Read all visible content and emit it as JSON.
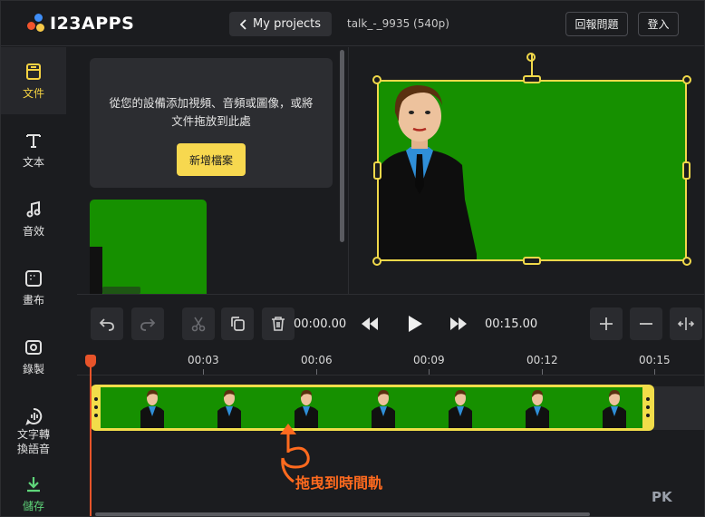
{
  "header": {
    "logo_text": "I23APPS",
    "projects_label": "My projects",
    "project_name": "talk_-_9935 (540p)",
    "report_label": "回報問題",
    "login_label": "登入"
  },
  "sidebar": {
    "items": [
      {
        "label": "文件",
        "icon": "file-icon"
      },
      {
        "label": "文本",
        "icon": "text-icon"
      },
      {
        "label": "音效",
        "icon": "music-note-icon"
      },
      {
        "label": "畫布",
        "icon": "canvas-icon"
      },
      {
        "label": "錄製",
        "icon": "record-icon"
      },
      {
        "label": "文字轉換語音",
        "label_line1": "文字轉",
        "label_line2": "換語音",
        "icon": "text-to-speech-icon"
      },
      {
        "label": "儲存",
        "icon": "download-icon"
      }
    ]
  },
  "files": {
    "drop_line1": "從您的設備添加視頻、音頻或圖像，或將",
    "drop_line2": "文件拖放到此處",
    "add_button": "新增檔案"
  },
  "controls": {
    "current_time": "00:00.00",
    "end_time": "00:15.00"
  },
  "timeline": {
    "ruler": [
      "00:03",
      "00:06",
      "00:09",
      "00:12",
      "00:15"
    ]
  },
  "annotation": "拖曳到時間軌",
  "watermark": "PK",
  "colors": {
    "accent_yellow": "#f2dd4a",
    "green_screen": "#169000",
    "save_green": "#5fd67a",
    "playhead": "#e8542a",
    "annotation_orange": "#ff6a1e"
  }
}
